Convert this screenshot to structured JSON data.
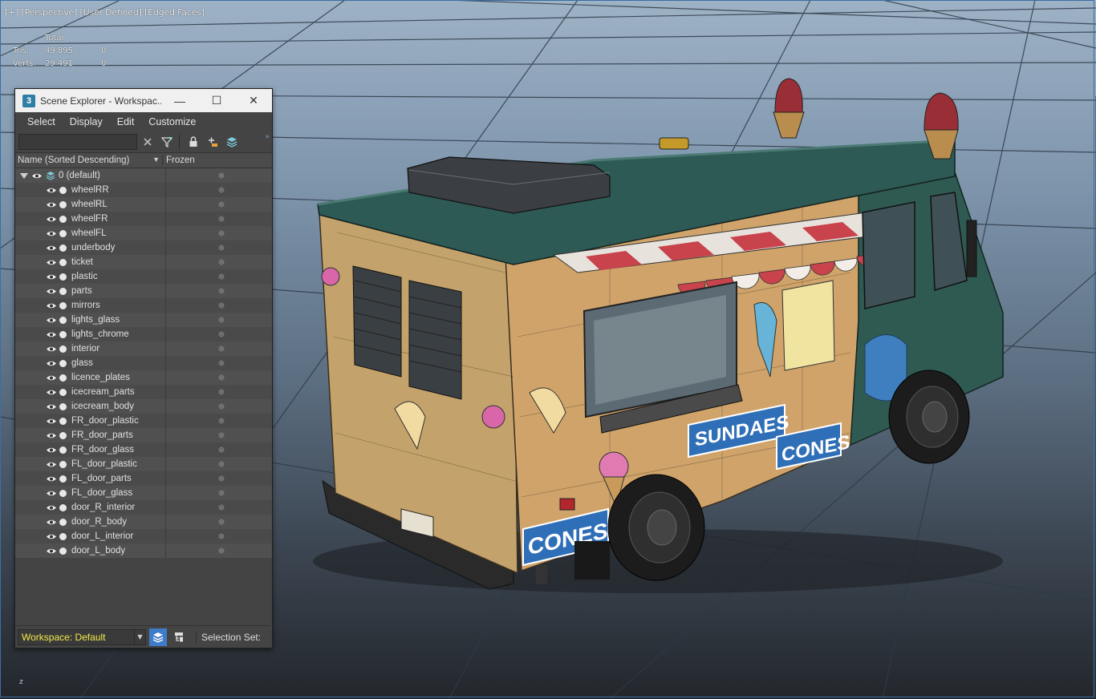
{
  "viewport": {
    "label_parts": [
      "[+]",
      "[Perspective]",
      "[User Defined]",
      "[Edged Faces]"
    ],
    "stats": {
      "header": "Total",
      "tris_label": "Tris:",
      "tris_total": "49 895",
      "tris_sel": "0",
      "verts_label": "Verts:",
      "verts_total": "29 491",
      "verts_sel": "0"
    },
    "truck_text": {
      "sundaes": "SUNDAES",
      "cones_side": "CONES",
      "cones_front": "CONES"
    },
    "axis_label": "z"
  },
  "scene_explorer": {
    "title": "Scene Explorer - Workspac...",
    "app_icon": "3",
    "window_controls": {
      "minimize": "—",
      "maximize": "☐",
      "close": "✕"
    },
    "menu": [
      "Select",
      "Display",
      "Edit",
      "Customize"
    ],
    "toolbar_icons": [
      "clear-icon",
      "filter-icon",
      "lock-icon",
      "add-to-layer-icon",
      "layers-icon"
    ],
    "columns": {
      "name": "Name (Sorted Descending)",
      "frozen": "Frozen"
    },
    "layer": {
      "name": "0 (default)"
    },
    "objects": [
      "wheelRR",
      "wheelRL",
      "wheelFR",
      "wheelFL",
      "underbody",
      "ticket",
      "plastic",
      "parts",
      "mirrors",
      "lights_glass",
      "lights_chrome",
      "interior",
      "glass",
      "licence_plates",
      "icecream_parts",
      "icecream_body",
      "FR_door_plastic",
      "FR_door_parts",
      "FR_door_glass",
      "FL_door_plastic",
      "FL_door_parts",
      "FL_door_glass",
      "door_R_interior",
      "door_R_body",
      "door_L_interior",
      "door_L_body"
    ],
    "workspace": "Workspace: Default",
    "selection_set_label": "Selection Set:",
    "colors": {
      "accent": "#3d7cc9",
      "workspace_text": "#f1e94a"
    }
  }
}
